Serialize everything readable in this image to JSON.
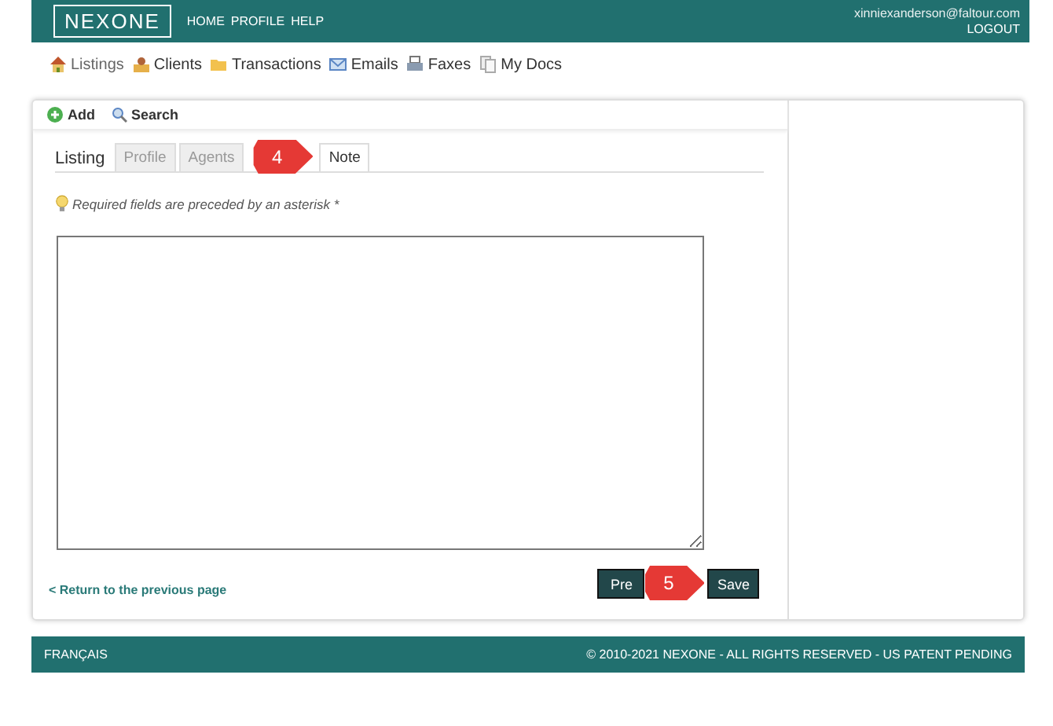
{
  "header": {
    "logo": "NEXONE",
    "menu": [
      "HOME",
      "PROFILE",
      "HELP"
    ],
    "email": "xinniexanderson@faltour.com",
    "logout": "LOGOUT"
  },
  "nav": [
    {
      "label": "Listings",
      "kind": "house",
      "selected": true
    },
    {
      "label": "Clients",
      "kind": "person",
      "selected": false
    },
    {
      "label": "Transactions",
      "kind": "folder",
      "selected": false
    },
    {
      "label": "Emails",
      "kind": "mail",
      "selected": false
    },
    {
      "label": "Faxes",
      "kind": "printer",
      "selected": false
    },
    {
      "label": "My Docs",
      "kind": "docs",
      "selected": false
    }
  ],
  "toolbar": [
    {
      "label": "Add",
      "kind": "add"
    },
    {
      "label": "Search",
      "kind": "search"
    }
  ],
  "tabs": [
    {
      "label": "Listing",
      "kind": "title",
      "selected": false
    },
    {
      "label": "Profile",
      "kind": "tab",
      "selected": false
    },
    {
      "label": "Agents",
      "kind": "tab",
      "selected": false
    },
    {
      "label": "4",
      "kind": "callout"
    },
    {
      "label": "Note",
      "kind": "tab",
      "selected": true
    }
  ],
  "hint": "Required fields are preceded by an asterisk *",
  "buttons": [
    {
      "label": "Pre",
      "kind": "button"
    },
    {
      "label": "5",
      "kind": "callout"
    },
    {
      "label": "Save",
      "kind": "button"
    }
  ],
  "back_link": "< Return to the previous page",
  "footer": {
    "language": "FRANÇAIS",
    "copyright": "© 2010-2021 NEXONE - ALL RIGHTS RESERVED - US PATENT PENDING"
  }
}
